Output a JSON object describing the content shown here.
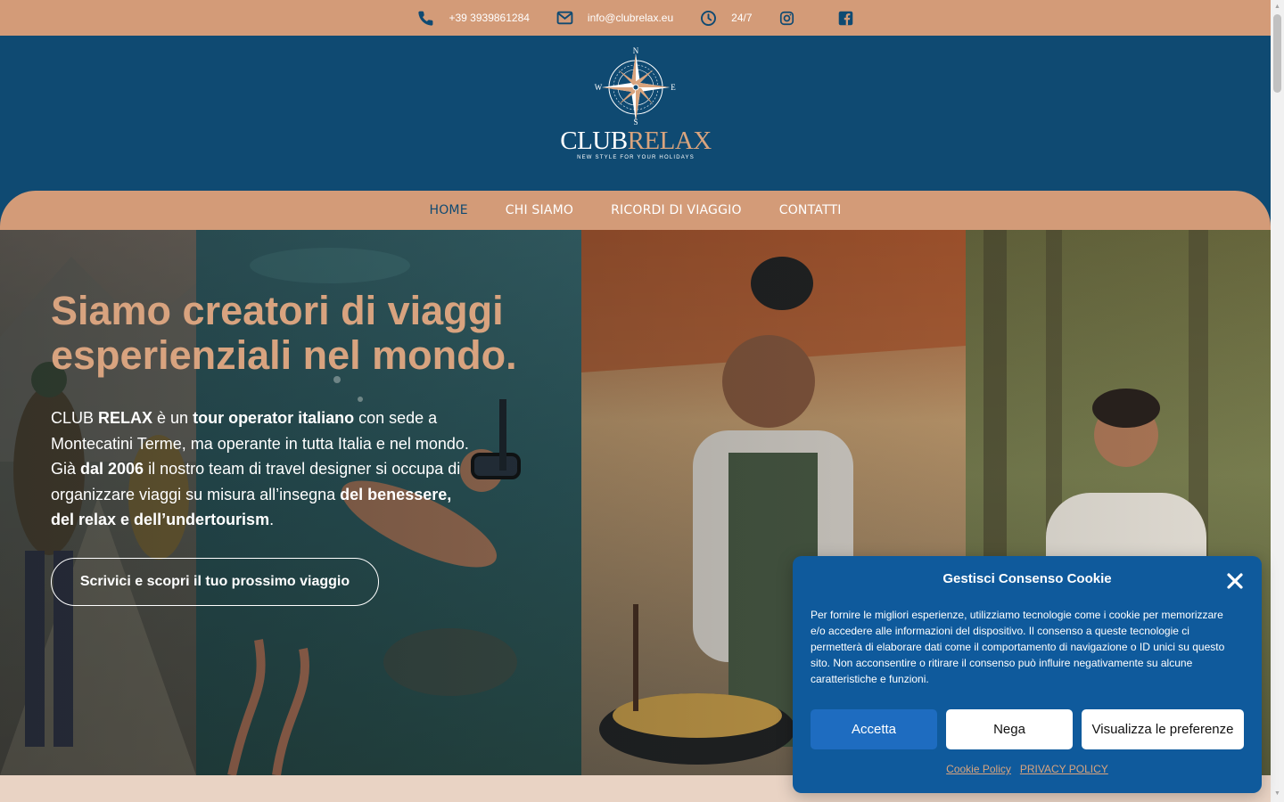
{
  "topbar": {
    "phone": "+39 3939861284",
    "email": "info@clubrelax.eu",
    "hours": "24/7",
    "icons": [
      "phone-icon",
      "envelope-icon",
      "clock-icon",
      "instagram-icon",
      "facebook-icon"
    ]
  },
  "brand": {
    "name_part1": "CLUB",
    "name_part2": "RELAX",
    "tagline": "NEW STYLE FOR YOUR HOLIDAYS",
    "compass_letters": [
      "N",
      "E",
      "S",
      "W"
    ]
  },
  "nav": {
    "items": [
      {
        "label": "HOME",
        "active": true
      },
      {
        "label": "CHI SIAMO",
        "active": false
      },
      {
        "label": "RICORDI DI VIAGGIO",
        "active": false
      },
      {
        "label": "CONTATTI",
        "active": false
      }
    ]
  },
  "hero": {
    "title": "Siamo creatori di viaggi esperienziali nel mondo.",
    "text_parts": [
      {
        "t": "CLUB ",
        "b": false
      },
      {
        "t": "RELAX",
        "b": true
      },
      {
        "t": " è un ",
        "b": false
      },
      {
        "t": "tour operator italiano",
        "b": true
      },
      {
        "t": " con sede a Montecatini Terme, ma operante in tutta Italia e nel mondo. Già ",
        "b": false
      },
      {
        "t": "dal 2006",
        "b": true
      },
      {
        "t": " il nostro team di travel designer si occupa di organizzare viaggi su misura all’insegna ",
        "b": false
      },
      {
        "t": "del benessere, del relax e dell’undertourism",
        "b": true
      },
      {
        "t": ".",
        "b": false
      }
    ],
    "cta": "Scrivici e scopri il tuo prossimo viaggio"
  },
  "cookie": {
    "title": "Gestisci Consenso Cookie",
    "body": "Per fornire le migliori esperienze, utilizziamo tecnologie come i cookie per memorizzare e/o accedere alle informazioni del dispositivo. Il consenso a queste tecnologie ci permetterà di elaborare dati come il comportamento di navigazione o ID unici su questo sito. Non acconsentire o ritirare il consenso può influire negativamente su alcune caratteristiche e funzioni.",
    "accept": "Accetta",
    "deny": "Nega",
    "prefs": "Visualizza le preferenze",
    "link_cookie": "Cookie Policy",
    "link_privacy": "PRIVACY POLICY"
  },
  "colors": {
    "accent": "#d39b78",
    "navy": "#0f4a72",
    "cookie_bg": "#0f5a9c",
    "cookie_accept": "#1e6cc0"
  }
}
